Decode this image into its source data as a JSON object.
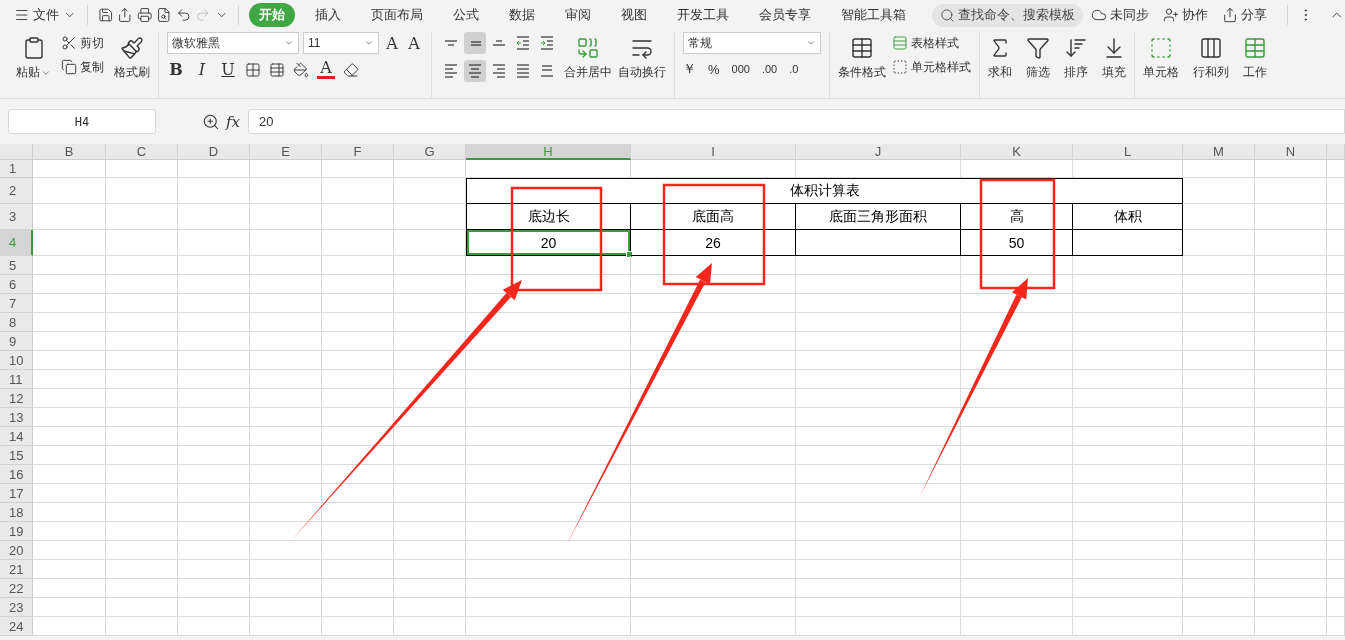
{
  "menu_bar": {
    "file_menu": "文件",
    "tabs": [
      {
        "label": "开始",
        "selected": true
      },
      {
        "label": "插入",
        "selected": false
      },
      {
        "label": "页面布局",
        "selected": false
      },
      {
        "label": "公式",
        "selected": false
      },
      {
        "label": "数据",
        "selected": false
      },
      {
        "label": "审阅",
        "selected": false
      },
      {
        "label": "视图",
        "selected": false
      },
      {
        "label": "开发工具",
        "selected": false
      },
      {
        "label": "会员专享",
        "selected": false
      },
      {
        "label": "智能工具箱",
        "selected": false
      }
    ],
    "search": {
      "placeholder": "查找命令、搜索模板"
    },
    "actions": [
      "未同步",
      "协作",
      "分享"
    ]
  },
  "ribbon": {
    "paste": "粘贴",
    "cut": "剪切",
    "copy": "复制",
    "format_painter": "格式刷",
    "font_name": "微软雅黑",
    "font_size": "11",
    "grow_font": "A",
    "shrink_font": "A",
    "bold": "B",
    "italic": "I",
    "underline": "U",
    "font_color": "A",
    "alignment_buttons": [
      {
        "kind": "top",
        "selected": false
      },
      {
        "kind": "middle",
        "selected": true
      },
      {
        "kind": "bottom",
        "selected": false
      },
      {
        "kind": "outdent",
        "selected": false
      },
      {
        "kind": "indent",
        "selected": false
      },
      {
        "kind": "left",
        "selected": false
      },
      {
        "kind": "center",
        "selected": true
      },
      {
        "kind": "right",
        "selected": false
      },
      {
        "kind": "justify",
        "selected": false
      },
      {
        "kind": "distribute",
        "selected": false
      }
    ],
    "merge_center": "合并居中",
    "wrap_text": "自动换行",
    "number_format": "常规",
    "currency": "￥",
    "percent": "%",
    "thousands": "000",
    "increase_decimal": ".00",
    "decrease_decimal": ".0",
    "conditional_format": "条件格式",
    "table_style": "表格样式",
    "cell_style": "单元格样式",
    "sum": "求和",
    "filter": "筛选",
    "sort": "排序",
    "fill": "填充",
    "cells": "单元格",
    "rows_cols": "行和列",
    "worksheet": "工作"
  },
  "formula_bar": {
    "name_box": "H4",
    "fx": "fx",
    "value": "20"
  },
  "sheet": {
    "columns": [
      {
        "label": "B",
        "selected": false
      },
      {
        "label": "C",
        "selected": false
      },
      {
        "label": "D",
        "selected": false
      },
      {
        "label": "E",
        "selected": false
      },
      {
        "label": "F",
        "selected": false
      },
      {
        "label": "G",
        "selected": false
      },
      {
        "label": "H",
        "selected": true
      },
      {
        "label": "I",
        "selected": false
      },
      {
        "label": "J",
        "selected": false
      },
      {
        "label": "K",
        "selected": false
      },
      {
        "label": "L",
        "selected": false
      },
      {
        "label": "M",
        "selected": false
      },
      {
        "label": "N",
        "selected": false
      }
    ],
    "rows": [
      {
        "label": "1",
        "selected": false
      },
      {
        "label": "2",
        "selected": false
      },
      {
        "label": "3",
        "selected": false
      },
      {
        "label": "4",
        "selected": true
      },
      {
        "label": "5",
        "selected": false
      },
      {
        "label": "6",
        "selected": false
      },
      {
        "label": "7",
        "selected": false
      },
      {
        "label": "8",
        "selected": false
      },
      {
        "label": "9",
        "selected": false
      },
      {
        "label": "10",
        "selected": false
      },
      {
        "label": "11",
        "selected": false
      },
      {
        "label": "12",
        "selected": false
      },
      {
        "label": "13",
        "selected": false
      },
      {
        "label": "14",
        "selected": false
      },
      {
        "label": "15",
        "selected": false
      },
      {
        "label": "16",
        "selected": false
      },
      {
        "label": "17",
        "selected": false
      },
      {
        "label": "18",
        "selected": false
      },
      {
        "label": "19",
        "selected": false
      },
      {
        "label": "20",
        "selected": false
      },
      {
        "label": "21",
        "selected": false
      },
      {
        "label": "22",
        "selected": false
      },
      {
        "label": "23",
        "selected": false
      },
      {
        "label": "24",
        "selected": false
      }
    ],
    "table": {
      "title": "体积计算表",
      "columns": [
        {
          "header": "底边长",
          "value": "20"
        },
        {
          "header": "底面高",
          "value": "26"
        },
        {
          "header": "底面三角形面积"
        },
        {
          "header": "高",
          "value": "50"
        },
        {
          "header": "体积"
        }
      ]
    }
  }
}
